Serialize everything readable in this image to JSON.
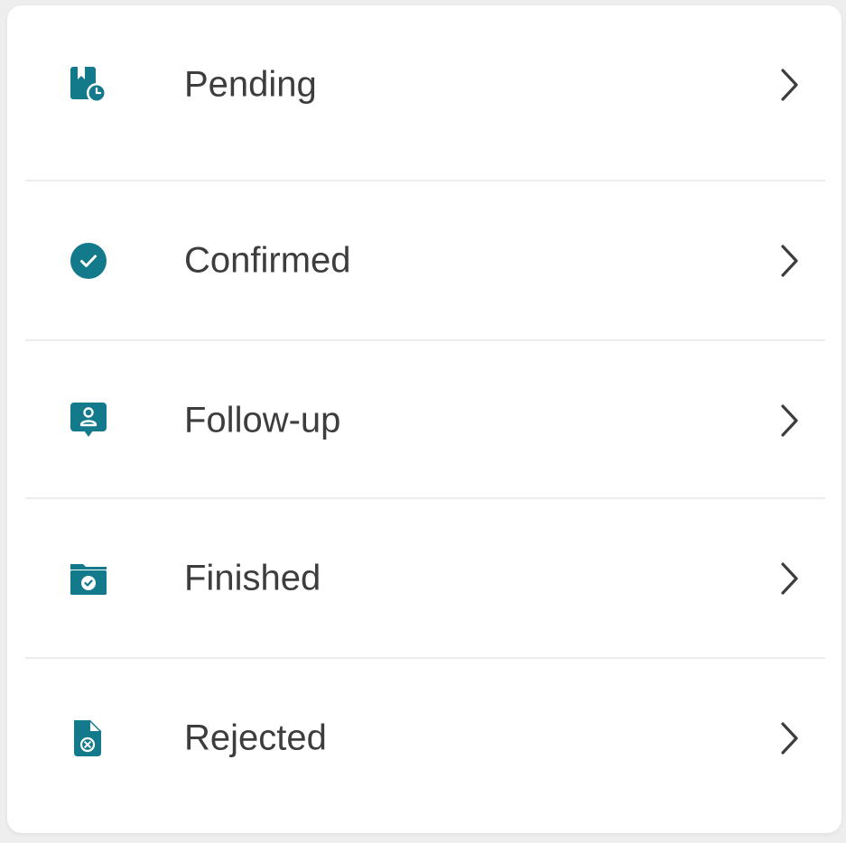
{
  "theme": {
    "icon_color": "#137a8c",
    "text_color": "#3d3d3d",
    "divider_color": "#ececec"
  },
  "menu": {
    "items": [
      {
        "label": "Pending",
        "icon": "bookmark-clock-icon"
      },
      {
        "label": "Confirmed",
        "icon": "check-circle-icon"
      },
      {
        "label": "Follow-up",
        "icon": "user-message-icon"
      },
      {
        "label": "Finished",
        "icon": "folder-check-icon"
      },
      {
        "label": "Rejected",
        "icon": "file-x-icon"
      }
    ]
  }
}
